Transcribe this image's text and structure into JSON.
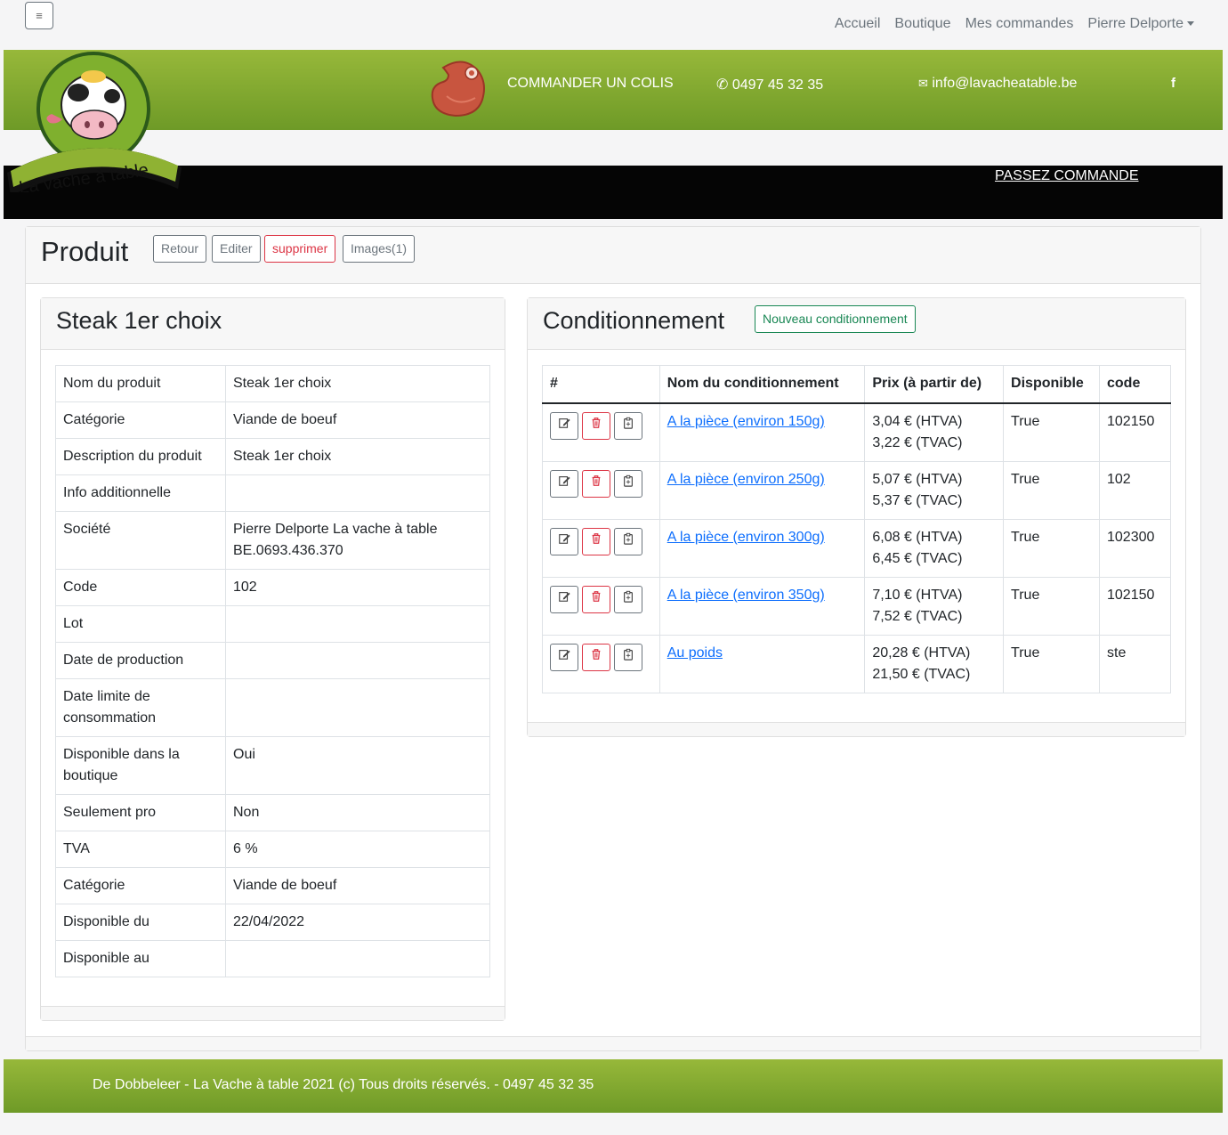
{
  "nav": {
    "links": [
      "Accueil",
      "Boutique",
      "Mes commandes"
    ],
    "user": "Pierre Delporte"
  },
  "header": {
    "logo_text": "La vache à table",
    "order_label": "COMMANDER UN COLIS",
    "phone": "0497 45 32 35",
    "email": "info@lavacheatable.be",
    "facebook": "f",
    "cta": "PASSEZ COMMANDE"
  },
  "page": {
    "title": "Produit",
    "buttons": {
      "back": "Retour",
      "edit": "Editer",
      "delete": "supprimer",
      "images": "Images(1)"
    }
  },
  "product": {
    "name": "Steak 1er choix",
    "rows": [
      {
        "label": "Nom du produit",
        "value": "Steak 1er choix"
      },
      {
        "label": "Catégorie",
        "value": "Viande de boeuf"
      },
      {
        "label": "Description du produit",
        "value": "Steak 1er choix"
      },
      {
        "label": "Info additionnelle",
        "value": ""
      },
      {
        "label": "Société",
        "value": "Pierre Delporte La vache à table BE.0693.436.370"
      },
      {
        "label": "Code",
        "value": "102"
      },
      {
        "label": "Lot",
        "value": ""
      },
      {
        "label": "Date de production",
        "value": ""
      },
      {
        "label": "Date limite de consommation",
        "value": ""
      },
      {
        "label": "Disponible dans la boutique",
        "value": "Oui"
      },
      {
        "label": "Seulement pro",
        "value": "Non"
      },
      {
        "label": "TVA",
        "value": "6 %"
      },
      {
        "label": "Catégorie",
        "value": "Viande de boeuf"
      },
      {
        "label": "Disponible du",
        "value": "22/04/2022"
      },
      {
        "label": "Disponible au",
        "value": ""
      }
    ]
  },
  "packaging": {
    "title": "Conditionnement",
    "new_button": "Nouveau conditionnement",
    "headers": [
      "#",
      "Nom du conditionnement",
      "Prix (à partir de)",
      "Disponible",
      "code"
    ],
    "rows": [
      {
        "name": "A la pièce (environ 150g)",
        "price_htva": "3,04 € (HTVA)",
        "price_tvac": "3,22 € (TVAC)",
        "available": "True",
        "code": "102150"
      },
      {
        "name": "A la pièce (environ 250g)",
        "price_htva": "5,07 € (HTVA)",
        "price_tvac": "5,37 € (TVAC)",
        "available": "True",
        "code": "102"
      },
      {
        "name": "A la pièce (environ 300g)",
        "price_htva": "6,08 € (HTVA)",
        "price_tvac": "6,45 € (TVAC)",
        "available": "True",
        "code": "102300"
      },
      {
        "name": "A la pièce (environ 350g)",
        "price_htva": "7,10 € (HTVA)",
        "price_tvac": "7,52 € (TVAC)",
        "available": "True",
        "code": "102150"
      },
      {
        "name": "Au poids",
        "price_htva": "20,28 € (HTVA)",
        "price_tvac": "21,50 € (TVAC)",
        "available": "True",
        "code": "ste"
      }
    ]
  },
  "footer": {
    "text": "De Dobbeleer - La Vache à table 2021 (c) Tous droits réservés. - 0497 45 32 35"
  },
  "colors": {
    "green_top": "#97b83a",
    "green_bottom": "#6e9a27",
    "danger": "#dc3545",
    "success": "#198754",
    "link": "#0d6efd"
  }
}
